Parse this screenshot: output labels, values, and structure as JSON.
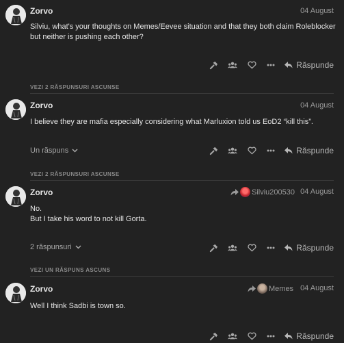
{
  "posts": [
    {
      "username": "Zorvo",
      "date": "04 August",
      "body": [
        "Silviu, what's your thoughts on Memes/Eevee situation and that they both claim Roleblocker but neither is pushing each other?"
      ],
      "replies": "",
      "reply_to": "",
      "reply_label": "Răspunde"
    },
    {
      "username": "Zorvo",
      "date": "04 August",
      "body": [
        "I believe they are mafia especially considering what Marluxion told us EoD2 “kill this”."
      ],
      "replies": "Un răspuns",
      "reply_to": "",
      "reply_label": "Răspunde"
    },
    {
      "username": "Zorvo",
      "date": "04 August",
      "body": [
        "No.",
        "But I take his word to not kill Gorta."
      ],
      "replies": "2 răspunsuri",
      "reply_to": "Silviu200530",
      "reply_label": "Răspunde"
    },
    {
      "username": "Zorvo",
      "date": "04 August",
      "body": [
        "Well I think Sadbi is town so."
      ],
      "replies": "",
      "reply_to": "Memes",
      "reply_label": "Răspunde"
    }
  ],
  "hidden_replies": [
    "VEZI 2 RĂSPUNSURI ASCUNSE",
    "VEZI 2 RĂSPUNSURI ASCUNSE",
    "VEZI UN RĂSPUNS ASCUNS"
  ],
  "icons": [
    "admin-wrench-icon",
    "users-icon",
    "heart-icon",
    "more-icon",
    "reply-icon",
    "chevron-down-icon",
    "share-arrow-icon"
  ],
  "colors": {
    "background": "#222222",
    "text": "#e6e6e6",
    "muted": "#9a9a9a"
  }
}
